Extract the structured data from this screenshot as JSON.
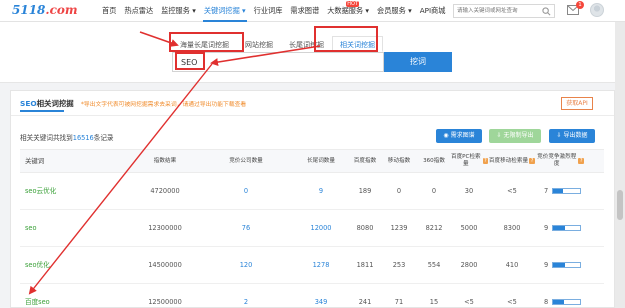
{
  "header": {
    "logo_text": "5118",
    "logo_suffix": ".com",
    "nav": [
      {
        "label": "首页",
        "active": false,
        "badge": ""
      },
      {
        "label": "热点雷达",
        "active": false,
        "badge": ""
      },
      {
        "label": "监控服务 ▾",
        "active": false,
        "badge": ""
      },
      {
        "label": "关键词挖掘 ▾",
        "active": true,
        "badge": ""
      },
      {
        "label": "行业词库",
        "active": false,
        "badge": ""
      },
      {
        "label": "需求图谱",
        "active": false,
        "badge": ""
      },
      {
        "label": "大数据服务 ▾",
        "active": false,
        "badge": "HOT"
      },
      {
        "label": "会员服务 ▾",
        "active": false,
        "badge": ""
      },
      {
        "label": "API商城",
        "active": false,
        "badge": ""
      }
    ],
    "search_placeholder": "请输入关键词或网址查询",
    "message_count": "1"
  },
  "search": {
    "tabs": [
      "海量长尾词挖掘",
      "网站挖掘",
      "长尾词挖掘",
      "相关词挖掘"
    ],
    "active_tab": 3,
    "keyword": "SEO",
    "button_label": "挖词"
  },
  "results": {
    "title_prefix": "SEO",
    "title_suffix": "相关词挖掘",
    "note": "*导出文字代表可被网挖掘需求去采词，请通过导出功能下载查看",
    "api_button": "获取API",
    "summary_prefix": "相关关键词共找到",
    "summary_count": "16516",
    "summary_suffix": "条记录",
    "actions": [
      "需求图谱",
      "无限制导出",
      "导出数据"
    ],
    "columns": [
      "关键词",
      "指数结果",
      "竞价公司数量",
      "长尾词数量",
      "百度指数",
      "移动指数",
      "360指数",
      "百度PC检索量",
      "百度移动检索量",
      "竞价竞争激烈程度"
    ],
    "rows": [
      {
        "keyword": "seo云优化",
        "index": "4720000",
        "companies": "0",
        "longtail": "9",
        "baidu": "189",
        "mobile": "0",
        "s360": "0",
        "pc_volume": "30",
        "mobile_volume": "<5",
        "competition": "7",
        "competition_level": 0.35
      },
      {
        "keyword": "seo",
        "index": "12300000",
        "companies": "76",
        "longtail": "12000",
        "baidu": "8080",
        "mobile": "1239",
        "s360": "8212",
        "pc_volume": "5000",
        "mobile_volume": "8300",
        "competition": "9",
        "competition_level": 0.45
      },
      {
        "keyword": "seo优化",
        "index": "14500000",
        "companies": "120",
        "longtail": "1278",
        "baidu": "1811",
        "mobile": "253",
        "s360": "554",
        "pc_volume": "2800",
        "mobile_volume": "410",
        "competition": "9",
        "competition_level": 0.45
      },
      {
        "keyword": "百度seo",
        "index": "12500000",
        "companies": "2",
        "longtail": "349",
        "baidu": "241",
        "mobile": "71",
        "s360": "15",
        "pc_volume": "<5",
        "mobile_volume": "<5",
        "competition": "8",
        "competition_level": 0.4
      }
    ]
  },
  "colors": {
    "brand": "#2a84d8",
    "annotation": "#e0302f",
    "keyword_green": "#3aa038",
    "note_orange": "#f08a2a"
  }
}
